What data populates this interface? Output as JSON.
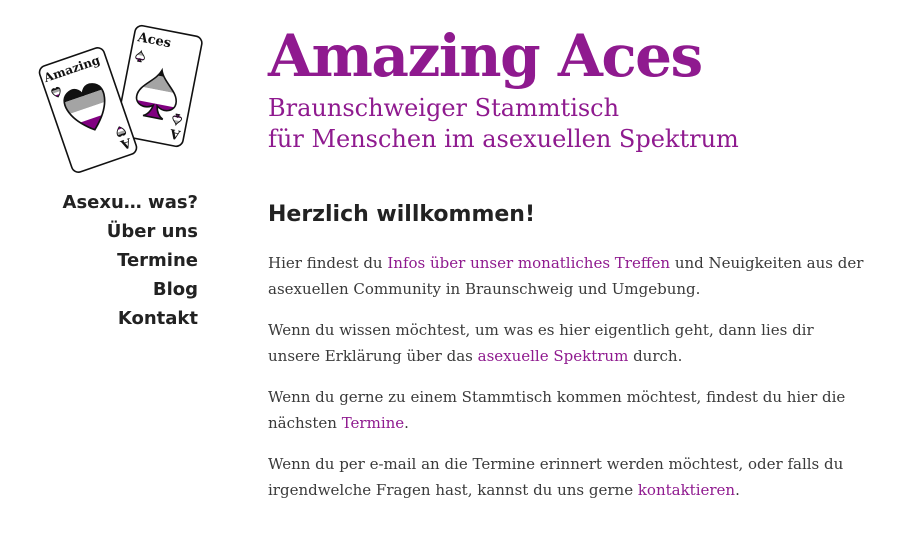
{
  "logo": {
    "card_left_text": "Amazing",
    "card_right_text": "Aces",
    "corner_letter": "A",
    "colors": {
      "black": "#111111",
      "gray": "#a4a4a4",
      "white": "#ffffff",
      "purple": "#800080"
    }
  },
  "header": {
    "title": "Amazing Aces",
    "subtitle_line1": "Braunschweiger Stammtisch",
    "subtitle_line2": "für Menschen im asexuellen Spektrum"
  },
  "nav": {
    "items": [
      {
        "label": "Asexu… was?"
      },
      {
        "label": "Über uns"
      },
      {
        "label": "Termine"
      },
      {
        "label": "Blog"
      },
      {
        "label": "Kontakt"
      }
    ]
  },
  "content": {
    "heading": "Herzlich willkommen!",
    "p1": {
      "pre": "Hier findest du ",
      "link": "Infos über unser monatliches Treffen",
      "post": " und Neuigkeiten aus der asexuellen Community in Braunschweig und Umgebung."
    },
    "p2": {
      "pre": "Wenn du wissen möchtest, um was es hier eigentlich geht, dann lies dir unsere Erklärung über das ",
      "link": "asexuelle Spektrum",
      "post": " durch."
    },
    "p3": {
      "pre": "Wenn du gerne zu einem Stammtisch kommen möchtest, findest du hier die nächsten ",
      "link": "Termine",
      "post": "."
    },
    "p4": {
      "pre": "Wenn du per e-mail an die Termine erinnert werden möchtest, oder falls du irgendwelche Fragen hast, kannst du uns gerne ",
      "link": "kontaktieren",
      "post": "."
    }
  },
  "theme": {
    "accent": "#8f1a8f",
    "text": "#3a3a3a",
    "nav_text": "#222222"
  }
}
